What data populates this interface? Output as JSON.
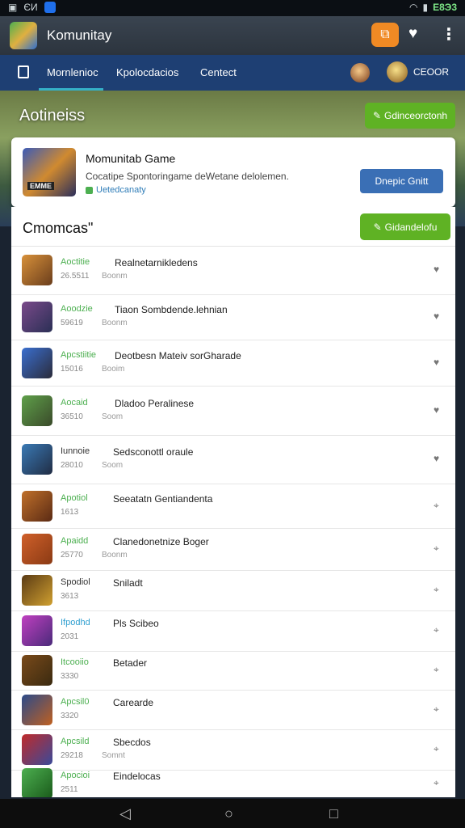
{
  "status_bar": {
    "left_icons": [
      "notification-icon",
      "sim-icon",
      "app-icon"
    ],
    "left_text": "ЄИ",
    "battery": "E8Э3"
  },
  "app_bar": {
    "title": "Komunitay",
    "cast_icon": "cast-icon",
    "heart_icon": "heart-icon",
    "more_icon": "more-vert-icon"
  },
  "nav": {
    "tabs": [
      "Mornlenioc",
      "Kpolocdacios",
      "Centect"
    ],
    "active_tab": 0,
    "user_label": "CEOOR"
  },
  "banner": {
    "title": "Aotineiss",
    "button_label": "Gdinceorctonh",
    "button_icon": "edit-icon"
  },
  "game": {
    "name": "Momunitab Game",
    "description": "Cocatipe Spontoringame deWetane delolemen.",
    "stat": "Uetedcanaty",
    "thumb_label": "EMME",
    "button_label": "Dnepic Gnitt"
  },
  "list": {
    "title": "Cmomcas\"",
    "header_button_label": "Gidandelofu",
    "header_button_icon": "edit-icon",
    "rows": [
      {
        "tag": "Aoctitie",
        "title": "Realnetarnikledens",
        "id": "26.5511",
        "sub": "Boonm",
        "tag_color": "#4caf50",
        "action": "♥"
      },
      {
        "tag": "Aoodzie",
        "title": "Tiaon Sombdende.lehnian",
        "id": "59619",
        "sub": "Boonm",
        "tag_color": "#4caf50",
        "action": "♥"
      },
      {
        "tag": "Apcstiitie",
        "title": "Deotbesn Mateiv sorGharade",
        "id": "15016",
        "sub": "Booim",
        "tag_color": "#4caf50",
        "action": "♥"
      },
      {
        "tag": "Aocaid",
        "title": "Dladoo Peralinese",
        "id": "36510",
        "sub": "Soom",
        "tag_color": "#4caf50",
        "action": "♥"
      },
      {
        "tag": "Iunnoie",
        "title": "Sedsconottl oraule",
        "id": "28010",
        "sub": "Soom",
        "tag_color": "#333333",
        "action": "♥"
      },
      {
        "tag": "Apotiol",
        "title": "Seeatatn Gentiandenta",
        "id": "1613",
        "sub": "",
        "tag_color": "#4caf50",
        "action": "⌖"
      },
      {
        "tag": "Apaidd",
        "title": "Clanedonetnize Boger",
        "id": "25770",
        "sub": "Boonm",
        "tag_color": "#4caf50",
        "action": "⌖"
      },
      {
        "tag": "Spodiol",
        "title": "Sniladt",
        "id": "3613",
        "sub": "",
        "tag_color": "#333333",
        "action": "⌖"
      },
      {
        "tag": "Ifpodhd",
        "title": "Pls Scibeo",
        "id": "2031",
        "sub": "",
        "tag_color": "#2f9fd0",
        "action": "⌖"
      },
      {
        "tag": "Itcooiio",
        "title": "Betader",
        "id": "3330",
        "sub": "",
        "tag_color": "#4caf50",
        "action": "⌖"
      },
      {
        "tag": "Apcsil0",
        "title": "Carearde",
        "id": "3320",
        "sub": "",
        "tag_color": "#4caf50",
        "action": "⌖"
      },
      {
        "tag": "Apcsild",
        "title": "Sbecdos",
        "id": "29218",
        "sub": "Somnt",
        "tag_color": "#4caf50",
        "action": "⌖"
      },
      {
        "tag": "Apocioi",
        "title": "Eindelocas",
        "id": "2511",
        "sub": "",
        "tag_color": "#4caf50",
        "action": "⌖"
      }
    ]
  },
  "bottom_nav": {
    "back": "◁",
    "home": "○",
    "recent": "□"
  },
  "colors": {
    "accent_green": "#5fb224",
    "accent_blue": "#3a6fb5",
    "nav_bg": "#1e3f73",
    "cast_orange": "#f08a24"
  }
}
